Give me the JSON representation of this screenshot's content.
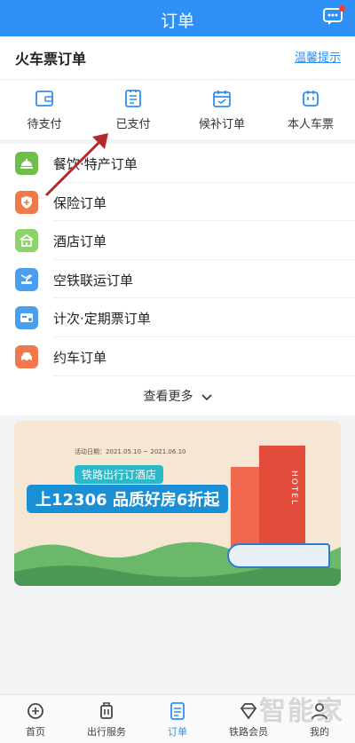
{
  "header": {
    "title": "订单"
  },
  "train_orders": {
    "title": "火车票订单",
    "tips_link": "温馨提示",
    "quick": [
      {
        "label": "待支付",
        "icon": "wallet-icon"
      },
      {
        "label": "已支付",
        "icon": "receipt-icon"
      },
      {
        "label": "候补订单",
        "icon": "calendar-icon"
      },
      {
        "label": "本人车票",
        "icon": "ticket-icon"
      }
    ]
  },
  "orders": [
    {
      "label": "餐饮·特产订单",
      "icon": "food-cover-icon",
      "color": "#6cc04a"
    },
    {
      "label": "保险订单",
      "icon": "shield-icon",
      "color": "#f0784a"
    },
    {
      "label": "酒店订单",
      "icon": "hotel-icon",
      "color": "#8cd36a"
    },
    {
      "label": "空铁联运订单",
      "icon": "plane-train-icon",
      "color": "#4a9ef0"
    },
    {
      "label": "计次·定期票订单",
      "icon": "card-icon",
      "color": "#4a9ef0"
    },
    {
      "label": "约车订单",
      "icon": "car-icon",
      "color": "#f0784a"
    }
  ],
  "more": {
    "label": "查看更多"
  },
  "banner": {
    "date_text": "活动日期：2021.05.10 ~ 2021.06.10",
    "headline1": "铁路出行订酒店",
    "headline2": "上12306 品质好房6折起",
    "sign": "HOTEL"
  },
  "tabs": [
    {
      "label": "首页",
      "icon": "home-icon",
      "active": false
    },
    {
      "label": "出行服务",
      "icon": "luggage-icon",
      "active": false
    },
    {
      "label": "订单",
      "icon": "order-icon",
      "active": true
    },
    {
      "label": "铁路会员",
      "icon": "diamond-icon",
      "active": false
    },
    {
      "label": "我的",
      "icon": "person-icon",
      "active": false
    }
  ],
  "watermark": "智能家",
  "colors": {
    "primary": "#2e8ff5",
    "arrow": "#b02a2a"
  }
}
